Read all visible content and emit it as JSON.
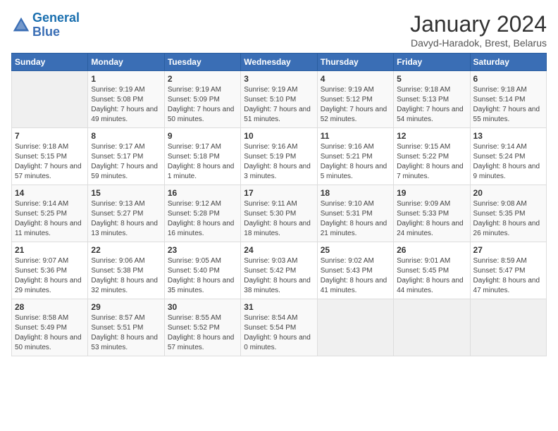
{
  "header": {
    "logo_line1": "General",
    "logo_line2": "Blue",
    "month": "January 2024",
    "location": "Davyd-Haradok, Brest, Belarus"
  },
  "weekdays": [
    "Sunday",
    "Monday",
    "Tuesday",
    "Wednesday",
    "Thursday",
    "Friday",
    "Saturday"
  ],
  "weeks": [
    [
      {
        "day": "",
        "sunrise": "",
        "sunset": "",
        "daylight": ""
      },
      {
        "day": "1",
        "sunrise": "Sunrise: 9:19 AM",
        "sunset": "Sunset: 5:08 PM",
        "daylight": "Daylight: 7 hours and 49 minutes."
      },
      {
        "day": "2",
        "sunrise": "Sunrise: 9:19 AM",
        "sunset": "Sunset: 5:09 PM",
        "daylight": "Daylight: 7 hours and 50 minutes."
      },
      {
        "day": "3",
        "sunrise": "Sunrise: 9:19 AM",
        "sunset": "Sunset: 5:10 PM",
        "daylight": "Daylight: 7 hours and 51 minutes."
      },
      {
        "day": "4",
        "sunrise": "Sunrise: 9:19 AM",
        "sunset": "Sunset: 5:12 PM",
        "daylight": "Daylight: 7 hours and 52 minutes."
      },
      {
        "day": "5",
        "sunrise": "Sunrise: 9:18 AM",
        "sunset": "Sunset: 5:13 PM",
        "daylight": "Daylight: 7 hours and 54 minutes."
      },
      {
        "day": "6",
        "sunrise": "Sunrise: 9:18 AM",
        "sunset": "Sunset: 5:14 PM",
        "daylight": "Daylight: 7 hours and 55 minutes."
      }
    ],
    [
      {
        "day": "7",
        "sunrise": "Sunrise: 9:18 AM",
        "sunset": "Sunset: 5:15 PM",
        "daylight": "Daylight: 7 hours and 57 minutes."
      },
      {
        "day": "8",
        "sunrise": "Sunrise: 9:17 AM",
        "sunset": "Sunset: 5:17 PM",
        "daylight": "Daylight: 7 hours and 59 minutes."
      },
      {
        "day": "9",
        "sunrise": "Sunrise: 9:17 AM",
        "sunset": "Sunset: 5:18 PM",
        "daylight": "Daylight: 8 hours and 1 minute."
      },
      {
        "day": "10",
        "sunrise": "Sunrise: 9:16 AM",
        "sunset": "Sunset: 5:19 PM",
        "daylight": "Daylight: 8 hours and 3 minutes."
      },
      {
        "day": "11",
        "sunrise": "Sunrise: 9:16 AM",
        "sunset": "Sunset: 5:21 PM",
        "daylight": "Daylight: 8 hours and 5 minutes."
      },
      {
        "day": "12",
        "sunrise": "Sunrise: 9:15 AM",
        "sunset": "Sunset: 5:22 PM",
        "daylight": "Daylight: 8 hours and 7 minutes."
      },
      {
        "day": "13",
        "sunrise": "Sunrise: 9:14 AM",
        "sunset": "Sunset: 5:24 PM",
        "daylight": "Daylight: 8 hours and 9 minutes."
      }
    ],
    [
      {
        "day": "14",
        "sunrise": "Sunrise: 9:14 AM",
        "sunset": "Sunset: 5:25 PM",
        "daylight": "Daylight: 8 hours and 11 minutes."
      },
      {
        "day": "15",
        "sunrise": "Sunrise: 9:13 AM",
        "sunset": "Sunset: 5:27 PM",
        "daylight": "Daylight: 8 hours and 13 minutes."
      },
      {
        "day": "16",
        "sunrise": "Sunrise: 9:12 AM",
        "sunset": "Sunset: 5:28 PM",
        "daylight": "Daylight: 8 hours and 16 minutes."
      },
      {
        "day": "17",
        "sunrise": "Sunrise: 9:11 AM",
        "sunset": "Sunset: 5:30 PM",
        "daylight": "Daylight: 8 hours and 18 minutes."
      },
      {
        "day": "18",
        "sunrise": "Sunrise: 9:10 AM",
        "sunset": "Sunset: 5:31 PM",
        "daylight": "Daylight: 8 hours and 21 minutes."
      },
      {
        "day": "19",
        "sunrise": "Sunrise: 9:09 AM",
        "sunset": "Sunset: 5:33 PM",
        "daylight": "Daylight: 8 hours and 24 minutes."
      },
      {
        "day": "20",
        "sunrise": "Sunrise: 9:08 AM",
        "sunset": "Sunset: 5:35 PM",
        "daylight": "Daylight: 8 hours and 26 minutes."
      }
    ],
    [
      {
        "day": "21",
        "sunrise": "Sunrise: 9:07 AM",
        "sunset": "Sunset: 5:36 PM",
        "daylight": "Daylight: 8 hours and 29 minutes."
      },
      {
        "day": "22",
        "sunrise": "Sunrise: 9:06 AM",
        "sunset": "Sunset: 5:38 PM",
        "daylight": "Daylight: 8 hours and 32 minutes."
      },
      {
        "day": "23",
        "sunrise": "Sunrise: 9:05 AM",
        "sunset": "Sunset: 5:40 PM",
        "daylight": "Daylight: 8 hours and 35 minutes."
      },
      {
        "day": "24",
        "sunrise": "Sunrise: 9:03 AM",
        "sunset": "Sunset: 5:42 PM",
        "daylight": "Daylight: 8 hours and 38 minutes."
      },
      {
        "day": "25",
        "sunrise": "Sunrise: 9:02 AM",
        "sunset": "Sunset: 5:43 PM",
        "daylight": "Daylight: 8 hours and 41 minutes."
      },
      {
        "day": "26",
        "sunrise": "Sunrise: 9:01 AM",
        "sunset": "Sunset: 5:45 PM",
        "daylight": "Daylight: 8 hours and 44 minutes."
      },
      {
        "day": "27",
        "sunrise": "Sunrise: 8:59 AM",
        "sunset": "Sunset: 5:47 PM",
        "daylight": "Daylight: 8 hours and 47 minutes."
      }
    ],
    [
      {
        "day": "28",
        "sunrise": "Sunrise: 8:58 AM",
        "sunset": "Sunset: 5:49 PM",
        "daylight": "Daylight: 8 hours and 50 minutes."
      },
      {
        "day": "29",
        "sunrise": "Sunrise: 8:57 AM",
        "sunset": "Sunset: 5:51 PM",
        "daylight": "Daylight: 8 hours and 53 minutes."
      },
      {
        "day": "30",
        "sunrise": "Sunrise: 8:55 AM",
        "sunset": "Sunset: 5:52 PM",
        "daylight": "Daylight: 8 hours and 57 minutes."
      },
      {
        "day": "31",
        "sunrise": "Sunrise: 8:54 AM",
        "sunset": "Sunset: 5:54 PM",
        "daylight": "Daylight: 9 hours and 0 minutes."
      },
      {
        "day": "",
        "sunrise": "",
        "sunset": "",
        "daylight": ""
      },
      {
        "day": "",
        "sunrise": "",
        "sunset": "",
        "daylight": ""
      },
      {
        "day": "",
        "sunrise": "",
        "sunset": "",
        "daylight": ""
      }
    ]
  ]
}
